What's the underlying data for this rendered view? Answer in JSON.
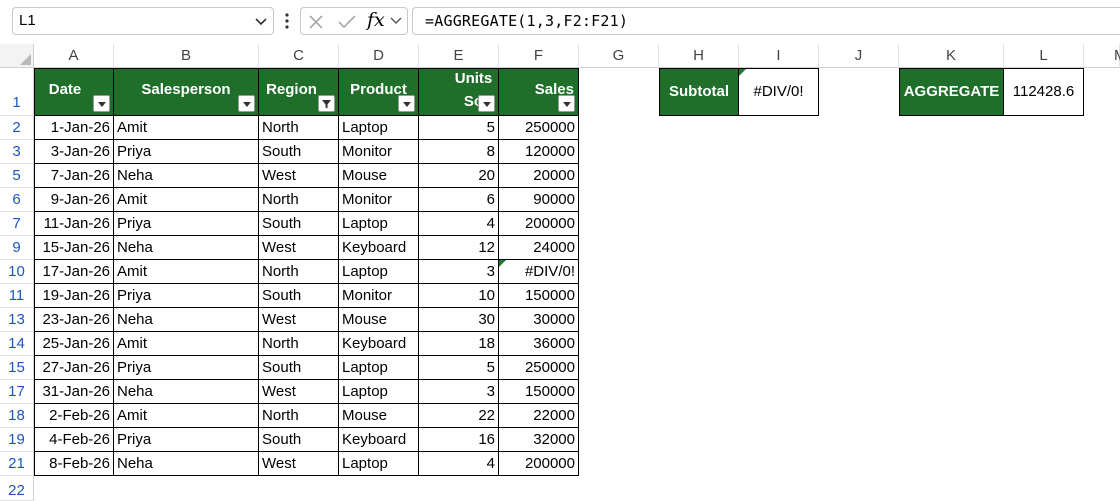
{
  "formula_bar": {
    "name_box": "L1",
    "cancel_icon": "x-icon",
    "enter_icon": "check-icon",
    "fx_label": "fx",
    "formula": "=AGGREGATE(1,3,F2:F21)"
  },
  "columns": [
    "A",
    "B",
    "C",
    "D",
    "E",
    "F",
    "G",
    "H",
    "I",
    "J",
    "K",
    "L",
    "M"
  ],
  "rows": [
    "1",
    "2",
    "3",
    "5",
    "6",
    "7",
    "9",
    "10",
    "11",
    "13",
    "14",
    "15",
    "17",
    "18",
    "19",
    "21",
    "22"
  ],
  "table": {
    "headers": [
      "Date",
      "Salesperson",
      "Region",
      "Product",
      "Units\nSo",
      "Sales"
    ],
    "header_line1_units": "Units",
    "header_line2_units": "So",
    "data": [
      [
        "1-Jan-26",
        "Amit",
        "North",
        "Laptop",
        "5",
        "250000"
      ],
      [
        "3-Jan-26",
        "Priya",
        "South",
        "Monitor",
        "8",
        "120000"
      ],
      [
        "7-Jan-26",
        "Neha",
        "West",
        "Mouse",
        "20",
        "20000"
      ],
      [
        "9-Jan-26",
        "Amit",
        "North",
        "Monitor",
        "6",
        "90000"
      ],
      [
        "11-Jan-26",
        "Priya",
        "South",
        "Laptop",
        "4",
        "200000"
      ],
      [
        "15-Jan-26",
        "Neha",
        "West",
        "Keyboard",
        "12",
        "24000"
      ],
      [
        "17-Jan-26",
        "Amit",
        "North",
        "Laptop",
        "3",
        "#DIV/0!"
      ],
      [
        "19-Jan-26",
        "Priya",
        "South",
        "Monitor",
        "10",
        "150000"
      ],
      [
        "23-Jan-26",
        "Neha",
        "West",
        "Mouse",
        "30",
        "30000"
      ],
      [
        "25-Jan-26",
        "Amit",
        "North",
        "Keyboard",
        "18",
        "36000"
      ],
      [
        "27-Jan-26",
        "Priya",
        "South",
        "Laptop",
        "5",
        "250000"
      ],
      [
        "31-Jan-26",
        "Neha",
        "West",
        "Laptop",
        "3",
        "150000"
      ],
      [
        "2-Feb-26",
        "Amit",
        "North",
        "Mouse",
        "22",
        "22000"
      ],
      [
        "4-Feb-26",
        "Priya",
        "South",
        "Keyboard",
        "16",
        "32000"
      ],
      [
        "8-Feb-26",
        "Neha",
        "West",
        "Laptop",
        "4",
        "200000"
      ]
    ]
  },
  "subtotal": {
    "label": "Subtotal",
    "value": "#DIV/0!"
  },
  "aggregate": {
    "label": "AGGREGATE",
    "value": "112428.6"
  },
  "colors": {
    "header_green": "#1f6e2a",
    "row_number_blue": "#1a56c4",
    "selection": "#1f7a2e"
  }
}
